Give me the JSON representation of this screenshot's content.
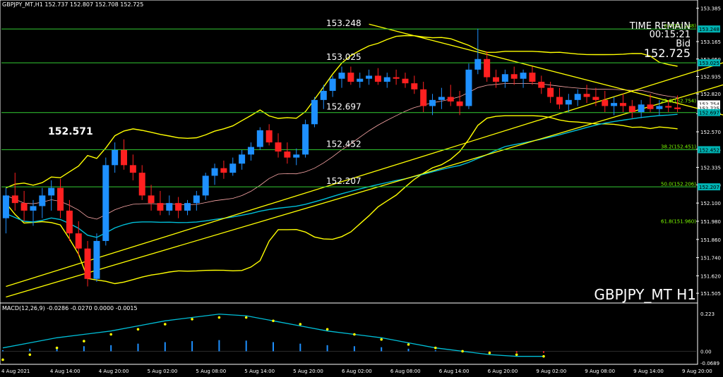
{
  "header": {
    "title": "GBPJPY_MT,H1  152.737 152.807 152.708 152.725"
  },
  "watermark": "GBPJPY_MT H1",
  "timer": {
    "label": "TIME REMAIN",
    "value": "00:15:21",
    "bid_label": "Bid",
    "bid_value": "152.725"
  },
  "levels": [
    {
      "label": "153.248",
      "price": 153.248
    },
    {
      "label": "153.025",
      "price": 153.025
    },
    {
      "label": "152.697",
      "price": 152.697
    },
    {
      "label": "152.452",
      "price": 152.452
    },
    {
      "label": "152.207",
      "price": 152.207
    }
  ],
  "swing_low_label": {
    "text": "152.571",
    "price": 152.571
  },
  "fibo": [
    {
      "label": "0.0(153.248)",
      "price": 153.248
    },
    {
      "label": "23.6(152.754)",
      "price": 152.754
    },
    {
      "label": "38.2(152.451)",
      "price": 152.451
    },
    {
      "label": "50.0(152.206)",
      "price": 152.206
    },
    {
      "label": "61.8(151.960)",
      "price": 151.96
    }
  ],
  "price_axis": {
    "ticks": [
      "153.385",
      "153.165",
      "153.050",
      "152.935",
      "152.820",
      "152.690",
      "152.570",
      "152.455",
      "152.335",
      "152.220",
      "152.100",
      "151.980",
      "151.860",
      "151.740",
      "151.620",
      "151.505"
    ],
    "tags": [
      {
        "text": "153.248",
        "price": 153.248,
        "color": "#00b3b3"
      },
      {
        "text": "153.025",
        "price": 153.025,
        "color": "#00b3b3"
      },
      {
        "text": "152.754",
        "price": 152.754,
        "color": "#000000"
      },
      {
        "text": "152.725",
        "price": 152.725,
        "color": "#000000"
      },
      {
        "text": "152.697",
        "price": 152.697,
        "color": "#00b3b3"
      },
      {
        "text": "152.452",
        "price": 152.452,
        "color": "#00b3b3"
      },
      {
        "text": "152.207",
        "price": 152.207,
        "color": "#00b3b3"
      }
    ]
  },
  "time_axis": [
    "4 Aug 2021",
    "4 Aug 14:00",
    "4 Aug 20:00",
    "5 Aug 02:00",
    "5 Aug 08:00",
    "5 Aug 14:00",
    "5 Aug 20:00",
    "6 Aug 02:00",
    "6 Aug 08:00",
    "6 Aug 14:00",
    "6 Aug 20:00",
    "9 Aug 02:00",
    "9 Aug 08:00",
    "9 Aug 14:00",
    "9 Aug 20:00"
  ],
  "macd": {
    "label": "MACD(12,26,9) -0.0286 -0.0270 0.0000 -0.0015",
    "ticks": [
      "0.223",
      "0.00",
      "-0.0689"
    ]
  },
  "colors": {
    "up": "#1e90ff",
    "down": "#ff2020",
    "level": "#33cc33",
    "fib": "#7cfc00",
    "band": "#ffff00",
    "ma": "#00bfd8",
    "signal": "#ffff00",
    "hist_up": "#1e90ff",
    "hist_down": "#ff2020"
  },
  "chart_data": {
    "type": "candlestick",
    "symbol": "GBPJPY_MT",
    "timeframe": "H1",
    "ylim": [
      151.45,
      153.43
    ],
    "ohlc": [
      [
        152.0,
        152.2,
        151.9,
        152.15
      ],
      [
        152.15,
        152.3,
        152.05,
        152.1
      ],
      [
        152.1,
        152.18,
        151.98,
        152.05
      ],
      [
        152.05,
        152.12,
        151.95,
        152.08
      ],
      [
        152.08,
        152.2,
        152.0,
        152.15
      ],
      [
        152.15,
        152.25,
        152.05,
        152.2
      ],
      [
        152.2,
        152.26,
        152.0,
        152.05
      ],
      [
        152.05,
        152.12,
        151.85,
        151.9
      ],
      [
        151.9,
        151.98,
        151.75,
        151.8
      ],
      [
        151.8,
        151.85,
        151.55,
        151.6
      ],
      [
        151.6,
        151.9,
        151.58,
        151.85
      ],
      [
        151.85,
        152.4,
        151.82,
        152.35
      ],
      [
        152.35,
        152.5,
        152.3,
        152.45
      ],
      [
        152.45,
        152.52,
        152.32,
        152.35
      ],
      [
        152.35,
        152.42,
        152.25,
        152.3
      ],
      [
        152.3,
        152.35,
        152.12,
        152.15
      ],
      [
        152.15,
        152.22,
        152.05,
        152.1
      ],
      [
        152.1,
        152.18,
        152.02,
        152.05
      ],
      [
        152.05,
        152.15,
        152.02,
        152.1
      ],
      [
        152.1,
        152.14,
        152.0,
        152.05
      ],
      [
        152.05,
        152.12,
        152.02,
        152.1
      ],
      [
        152.1,
        152.18,
        152.05,
        152.15
      ],
      [
        152.15,
        152.3,
        152.12,
        152.28
      ],
      [
        152.28,
        152.36,
        152.22,
        152.33
      ],
      [
        152.33,
        152.38,
        152.26,
        152.3
      ],
      [
        152.3,
        152.4,
        152.28,
        152.36
      ],
      [
        152.36,
        152.45,
        152.32,
        152.42
      ],
      [
        152.42,
        152.5,
        152.38,
        152.47
      ],
      [
        152.47,
        152.6,
        152.45,
        152.58
      ],
      [
        152.58,
        152.62,
        152.48,
        152.5
      ],
      [
        152.5,
        152.56,
        152.4,
        152.44
      ],
      [
        152.44,
        152.5,
        152.36,
        152.4
      ],
      [
        152.4,
        152.46,
        152.35,
        152.42
      ],
      [
        152.42,
        152.65,
        152.4,
        152.62
      ],
      [
        152.62,
        152.8,
        152.6,
        152.78
      ],
      [
        152.78,
        152.88,
        152.72,
        152.84
      ],
      [
        152.84,
        152.94,
        152.8,
        152.92
      ],
      [
        152.92,
        153.0,
        152.86,
        152.96
      ],
      [
        152.96,
        153.0,
        152.88,
        152.9
      ],
      [
        152.9,
        152.96,
        152.86,
        152.92
      ],
      [
        152.92,
        152.98,
        152.88,
        152.94
      ],
      [
        152.94,
        152.99,
        152.88,
        152.9
      ],
      [
        152.9,
        152.96,
        152.86,
        152.93
      ],
      [
        152.93,
        152.98,
        152.88,
        152.92
      ],
      [
        152.92,
        152.96,
        152.86,
        152.89
      ],
      [
        152.89,
        152.94,
        152.82,
        152.85
      ],
      [
        152.85,
        152.9,
        152.7,
        152.74
      ],
      [
        152.74,
        152.82,
        152.68,
        152.78
      ],
      [
        152.78,
        152.86,
        152.72,
        152.8
      ],
      [
        152.8,
        152.88,
        152.74,
        152.77
      ],
      [
        152.77,
        152.84,
        152.68,
        152.74
      ],
      [
        152.74,
        153.02,
        152.72,
        152.98
      ],
      [
        152.98,
        153.25,
        152.95,
        153.05
      ],
      [
        153.05,
        153.1,
        152.9,
        152.93
      ],
      [
        152.93,
        152.98,
        152.86,
        152.9
      ],
      [
        152.9,
        152.98,
        152.86,
        152.95
      ],
      [
        152.95,
        153.0,
        152.88,
        152.92
      ],
      [
        152.92,
        152.98,
        152.86,
        152.96
      ],
      [
        152.96,
        153.0,
        152.88,
        152.9
      ],
      [
        152.9,
        152.94,
        152.82,
        152.86
      ],
      [
        152.86,
        152.9,
        152.76,
        152.8
      ],
      [
        152.8,
        152.86,
        152.72,
        152.75
      ],
      [
        152.75,
        152.82,
        152.7,
        152.78
      ],
      [
        152.78,
        152.85,
        152.74,
        152.82
      ],
      [
        152.82,
        152.88,
        152.76,
        152.8
      ],
      [
        152.8,
        152.86,
        152.74,
        152.78
      ],
      [
        152.78,
        152.84,
        152.7,
        152.74
      ],
      [
        152.74,
        152.8,
        152.68,
        152.76
      ],
      [
        152.76,
        152.82,
        152.7,
        152.74
      ],
      [
        152.74,
        152.78,
        152.66,
        152.7
      ],
      [
        152.7,
        152.78,
        152.66,
        152.75
      ],
      [
        152.75,
        152.82,
        152.7,
        152.72
      ],
      [
        152.72,
        152.78,
        152.68,
        152.74
      ],
      [
        152.74,
        152.78,
        152.7,
        152.73
      ],
      [
        152.73,
        152.81,
        152.7,
        152.72
      ]
    ],
    "macd_main": [
      0.02,
      0.05,
      0.08,
      0.1,
      0.12,
      0.15,
      0.18,
      0.2,
      0.22,
      0.21,
      0.18,
      0.15,
      0.12,
      0.1,
      0.08,
      0.05,
      0.02,
      0.0,
      -0.02,
      -0.03,
      -0.03
    ],
    "macd_signal": [
      -0.05,
      -0.02,
      0.02,
      0.06,
      0.1,
      0.13,
      0.16,
      0.19,
      0.2,
      0.2,
      0.18,
      0.16,
      0.13,
      0.1,
      0.07,
      0.04,
      0.02,
      0.0,
      -0.01,
      -0.02,
      -0.03
    ]
  }
}
